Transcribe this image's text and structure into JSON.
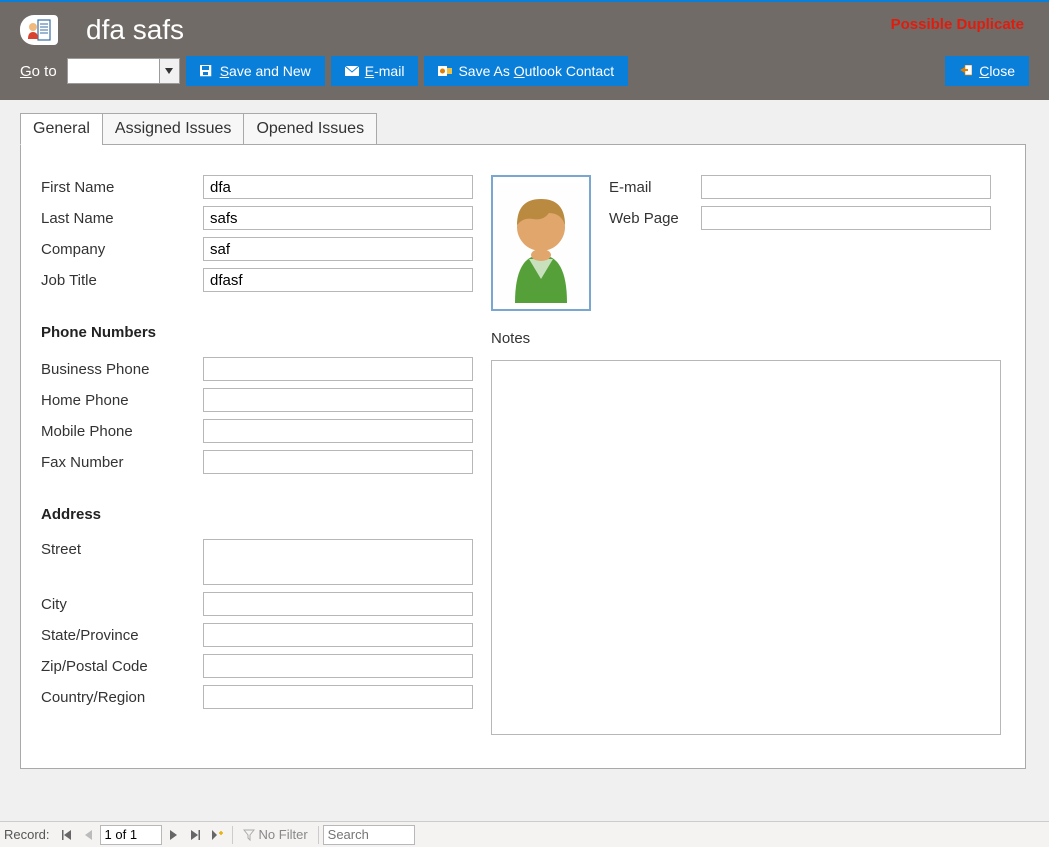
{
  "header": {
    "title": "dfa safs",
    "duplicate_warning": "Possible Duplicate"
  },
  "toolbar": {
    "goto_prefix": "G",
    "goto_suffix": "o to",
    "save_new_prefix": "",
    "save_new_u": "S",
    "save_new_suffix": "ave and New",
    "email_u": "E",
    "email_suffix": "-mail",
    "outlook_prefix": "Save As ",
    "outlook_u": "O",
    "outlook_suffix": "utlook Contact",
    "close_u": "C",
    "close_suffix": "lose"
  },
  "tabs": {
    "general": "General",
    "assigned": "Assigned Issues",
    "opened": "Opened Issues"
  },
  "labels": {
    "first_name": "First Name",
    "last_name": "Last Name",
    "company": "Company",
    "job_title": "Job Title",
    "phone_section": "Phone Numbers",
    "business_phone": "Business Phone",
    "home_phone": "Home Phone",
    "mobile_phone": "Mobile Phone",
    "fax": "Fax Number",
    "address_section": "Address",
    "street": "Street",
    "city": "City",
    "state": "State/Province",
    "zip": "Zip/Postal Code",
    "country": "Country/Region",
    "email": "E-mail",
    "web": "Web Page",
    "notes": "Notes"
  },
  "values": {
    "first_name": "dfa",
    "last_name": "safs",
    "company": "saf",
    "job_title": "dfasf",
    "business_phone": "",
    "home_phone": "",
    "mobile_phone": "",
    "fax": "",
    "street": "",
    "city": "",
    "state": "",
    "zip": "",
    "country": "",
    "email": "",
    "web": "",
    "notes": ""
  },
  "statusbar": {
    "record_label": "Record:",
    "record_value": "1 of 1",
    "filter_label": "No Filter",
    "search_placeholder": "Search"
  }
}
